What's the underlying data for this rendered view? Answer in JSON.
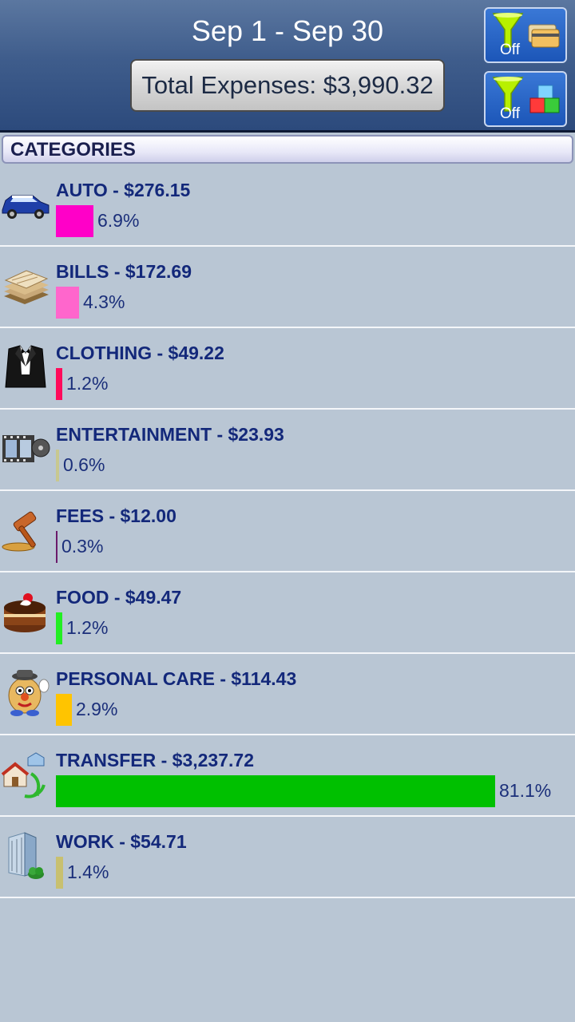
{
  "header": {
    "date_range": "Sep 1 - Sep 30",
    "total_label": "Total Expenses: $3,990.32",
    "filter_account": {
      "label": "Off",
      "icon": "funnel-cards-icon"
    },
    "filter_category": {
      "label": "Off",
      "icon": "funnel-blocks-icon"
    }
  },
  "section_title": "CATEGORIES",
  "categories": [
    {
      "title": "AUTO - $276.15",
      "percent": "6.9%",
      "share": 6.9,
      "color": "#ff00c8",
      "icon": "car-icon"
    },
    {
      "title": "BILLS - $172.69",
      "percent": "4.3%",
      "share": 4.3,
      "color": "#ff66cc",
      "icon": "bills-stack-icon"
    },
    {
      "title": "CLOTHING - $49.22",
      "percent": "1.2%",
      "share": 1.2,
      "color": "#ff0a5a",
      "icon": "tuxedo-icon"
    },
    {
      "title": "ENTERTAINMENT - $23.93",
      "percent": "0.6%",
      "share": 0.6,
      "color": "#c8c890",
      "icon": "film-reel-icon"
    },
    {
      "title": "FEES - $12.00",
      "percent": "0.3%",
      "share": 0.3,
      "color": "#6a1a6a",
      "icon": "gavel-icon"
    },
    {
      "title": "FOOD - $49.47",
      "percent": "1.2%",
      "share": 1.2,
      "color": "#22ee22",
      "icon": "cake-icon"
    },
    {
      "title": "PERSONAL CARE - $114.43",
      "percent": "2.9%",
      "share": 2.9,
      "color": "#ffc400",
      "icon": "potato-head-icon"
    },
    {
      "title": "TRANSFER - $3,237.72",
      "percent": "81.1%",
      "share": 81.1,
      "color": "#00c000",
      "icon": "house-transfer-icon"
    },
    {
      "title": "WORK - $54.71",
      "percent": "1.4%",
      "share": 1.4,
      "color": "#c8c070",
      "icon": "office-building-icon"
    }
  ]
}
